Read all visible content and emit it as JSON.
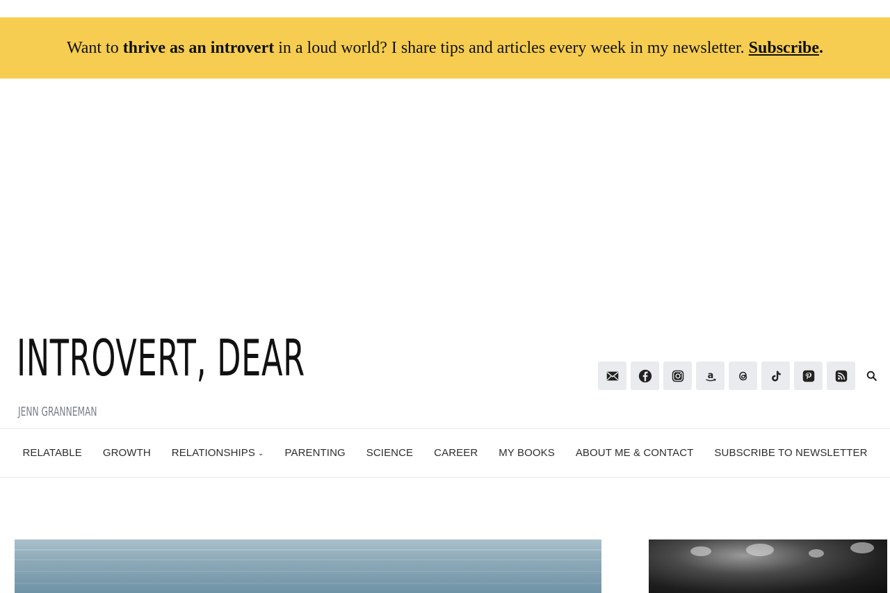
{
  "banner": {
    "text_before": "Want to ",
    "text_bold": "thrive as an introvert",
    "text_after": " in a loud world? I share tips and articles every week in my newsletter. ",
    "link_label": "Subscribe",
    "link_end": "."
  },
  "site": {
    "title": "INTROVERT, DEAR",
    "tagline": "JENN GRANNEMAN"
  },
  "social": {
    "items": [
      {
        "icon": "mail-icon"
      },
      {
        "icon": "facebook-icon"
      },
      {
        "icon": "instagram-icon"
      },
      {
        "icon": "amazon-icon"
      },
      {
        "icon": "threads-icon"
      },
      {
        "icon": "tiktok-icon"
      },
      {
        "icon": "pinterest-icon"
      },
      {
        "icon": "rss-icon"
      }
    ],
    "search_icon": "search-icon"
  },
  "nav": {
    "items": [
      {
        "label": "RELATABLE"
      },
      {
        "label": "GROWTH"
      },
      {
        "label": "RELATIONSHIPS"
      },
      {
        "label": "PARENTING"
      },
      {
        "label": "SCIENCE"
      },
      {
        "label": "CAREER"
      },
      {
        "label": "MY BOOKS"
      },
      {
        "label": "ABOUT ME & CONTACT"
      },
      {
        "label": "SUBSCRIBE TO NEWSLETTER"
      }
    ]
  },
  "colors": {
    "banner_bg": "#f6cd50",
    "icon_bg": "#e9ebee",
    "tagline": "#7a7f8a"
  }
}
